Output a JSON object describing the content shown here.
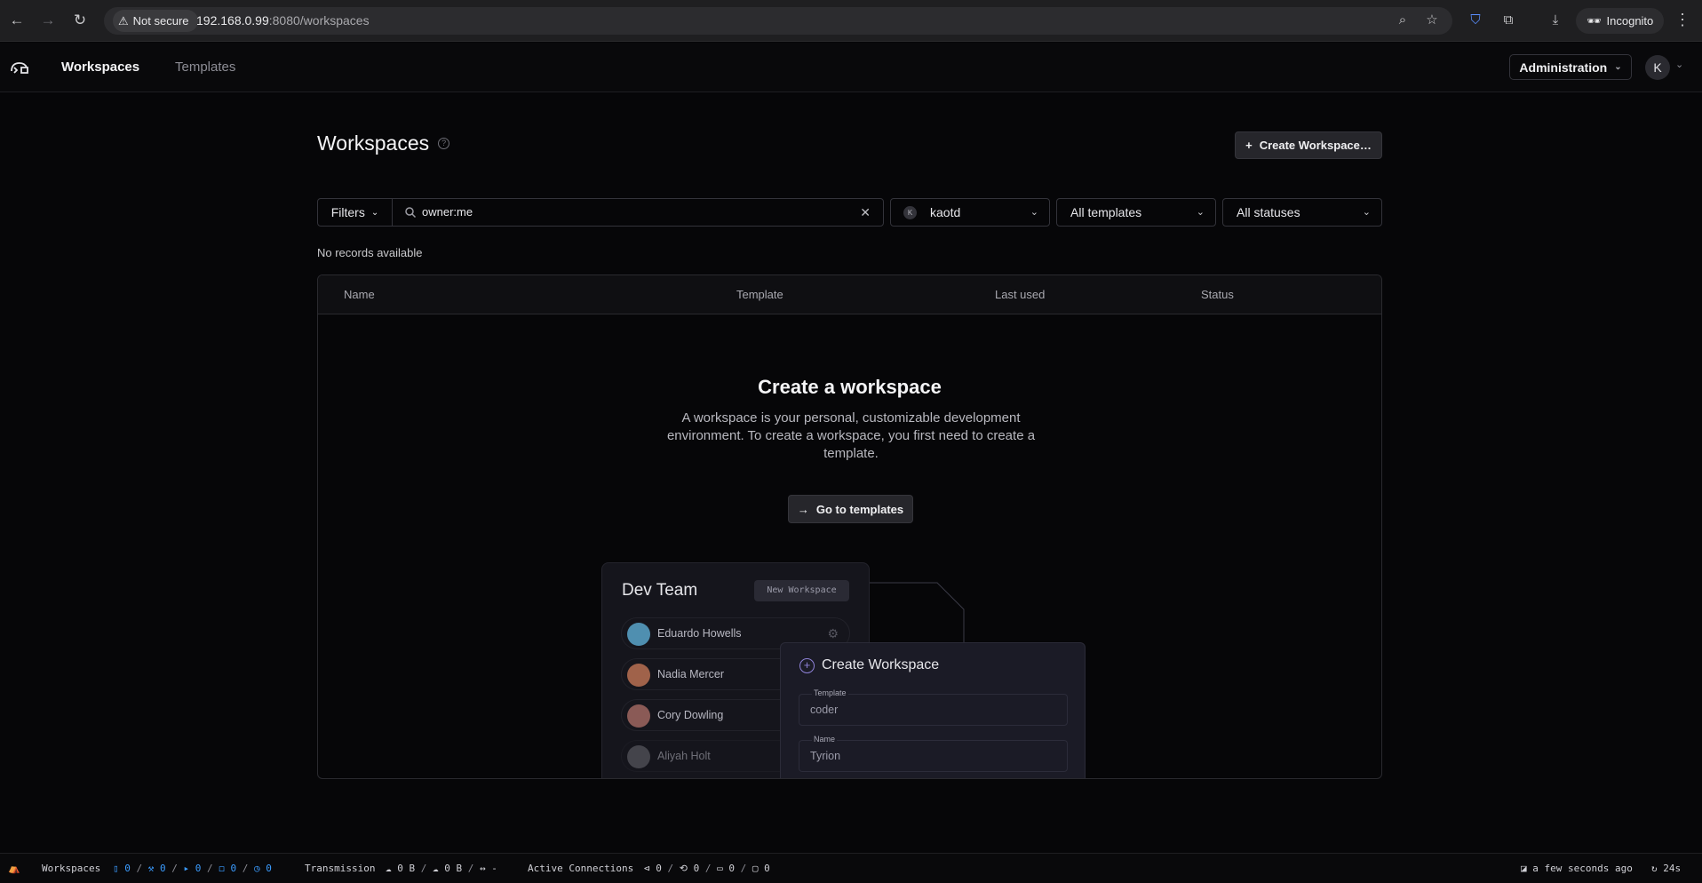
{
  "browser": {
    "security_label": "Not secure",
    "url_host": "192.168.0.99",
    "url_rest": ":8080/workspaces",
    "profile_label": "Incognito"
  },
  "nav": {
    "links": [
      "Workspaces",
      "Templates"
    ],
    "admin_label": "Administration",
    "avatar_initial": "K"
  },
  "page": {
    "title": "Workspaces",
    "create_button": "Create Workspace…",
    "create_button_icon": "plus-icon"
  },
  "filters": {
    "filters_label": "Filters",
    "search_value": "owner:me",
    "owner_dropdown": {
      "avatar_initial": "K",
      "value": "kaotd"
    },
    "template_dropdown": "All templates",
    "status_dropdown": "All statuses"
  },
  "table": {
    "records_text": "No records available",
    "columns": [
      "Name",
      "Template",
      "Last used",
      "Status"
    ]
  },
  "empty_state": {
    "title": "Create a workspace",
    "description": "A workspace is your personal, customizable development environment. To create a workspace, you first need to create a template.",
    "button": "Go to templates"
  },
  "illustration": {
    "team_title": "Dev Team",
    "chip": "New Workspace",
    "members": [
      "Eduardo Howells",
      "Nadia Mercer",
      "Cory Dowling",
      "Aliyah Holt"
    ],
    "create_title": "Create Workspace",
    "fields": [
      {
        "label": "Template",
        "value": "coder"
      },
      {
        "label": "Name",
        "value": "Tyrion"
      }
    ]
  },
  "statusbar": {
    "workspaces_label": "Workspaces",
    "counts": [
      "0",
      "0",
      "0",
      "0",
      "0"
    ],
    "transmission_label": "Transmission",
    "upload": "0 B",
    "download": "0 B",
    "latency": "-",
    "connections_label": "Active Connections",
    "conn_counts": [
      "0",
      "0",
      "0",
      "0"
    ],
    "updated": "a few seconds ago",
    "refresh": "24s"
  },
  "colors": {
    "background": "#060608",
    "accent_blue": "#3b9cff",
    "illustration_accent": "#8f82d8"
  }
}
